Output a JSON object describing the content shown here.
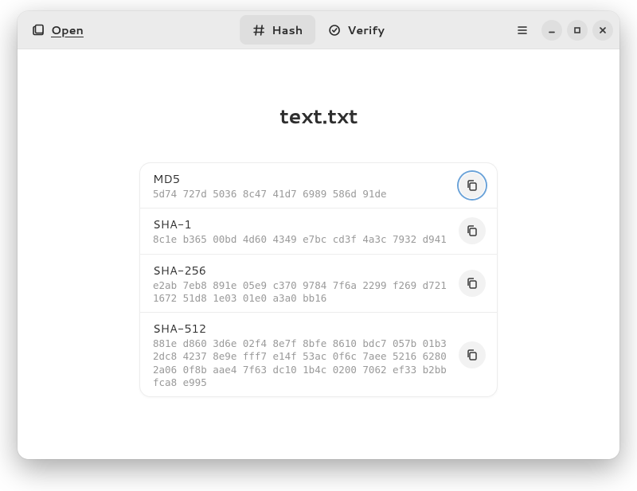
{
  "header": {
    "open_label": "Open",
    "tabs": [
      {
        "id": "hash",
        "label": "Hash",
        "active": true
      },
      {
        "id": "verify",
        "label": "Verify",
        "active": false
      }
    ]
  },
  "file": {
    "name": "text.txt"
  },
  "hashes": [
    {
      "algo": "MD5",
      "value": "5d74 727d 5036 8c47 41d7 6989 586d 91de",
      "focused": true
    },
    {
      "algo": "SHA-1",
      "value": "8c1e b365 00bd 4d60 4349 e7bc cd3f 4a3c 7932 d941",
      "focused": false
    },
    {
      "algo": "SHA-256",
      "value": "e2ab 7eb8 891e 05e9 c370 9784 7f6a 2299 f269 d721 1672 51d8 1e03 01e0 a3a0 bb16",
      "focused": false
    },
    {
      "algo": "SHA-512",
      "value": "881e d860 3d6e 02f4 8e7f 8bfe 8610 bdc7 057b 01b3 2dc8 4237 8e9e fff7 e14f 53ac 0f6c 7aee 5216 6280 2a06 0f8b aae4 7f63 dc10 1b4c 0200 7062 ef33 b2bb fca8 e995",
      "focused": false
    }
  ]
}
